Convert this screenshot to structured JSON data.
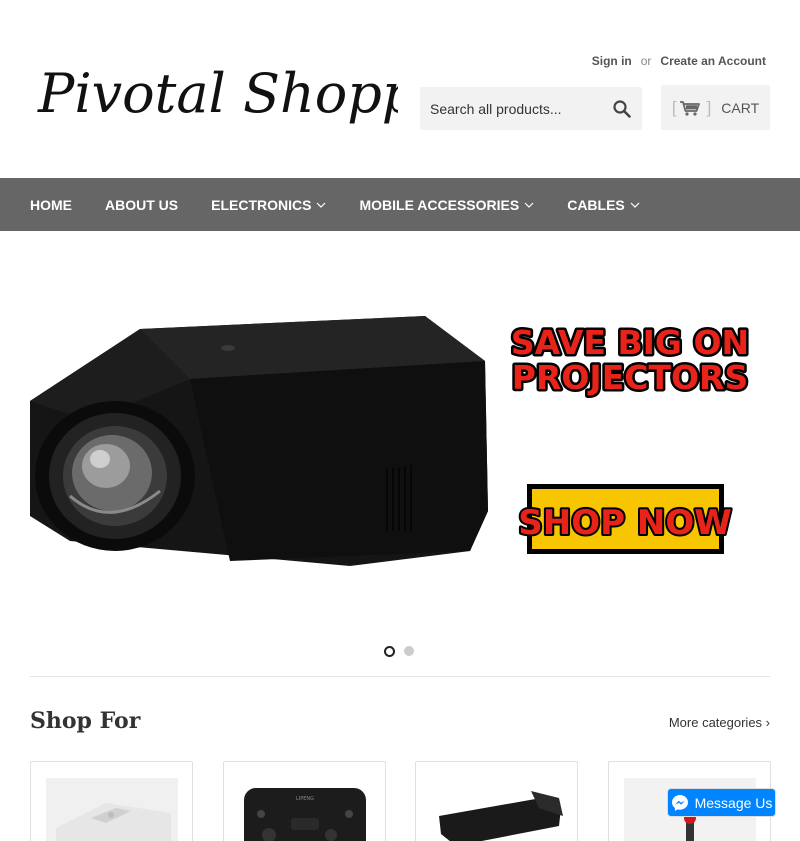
{
  "header": {
    "logo_text": "Pivotal Shopping",
    "sign_in": "Sign in",
    "or": "or",
    "create_account": "Create an Account",
    "search_placeholder": "Search all products...",
    "search_button": "Search",
    "cart_label": "CART"
  },
  "nav": {
    "items": [
      {
        "label": "HOME",
        "dropdown": false
      },
      {
        "label": "ABOUT US",
        "dropdown": false
      },
      {
        "label": "ELECTRONICS",
        "dropdown": true
      },
      {
        "label": "MOBILE ACCESSORIES",
        "dropdown": true
      },
      {
        "label": "CABLES",
        "dropdown": true
      }
    ]
  },
  "hero": {
    "headline_line1": "SAVE BIG ON",
    "headline_line2": "PROJECTORS",
    "cta": "SHOP NOW",
    "slide_count": 2,
    "active_slide": 1
  },
  "shop_for": {
    "title": "Shop For",
    "more_link": "More categories ›"
  },
  "messenger": {
    "label": "Message Us"
  },
  "colors": {
    "nav_bg": "#666666",
    "cta_yellow": "#f7c600",
    "cta_red": "#e8231a",
    "messenger_blue": "#0084ff"
  }
}
